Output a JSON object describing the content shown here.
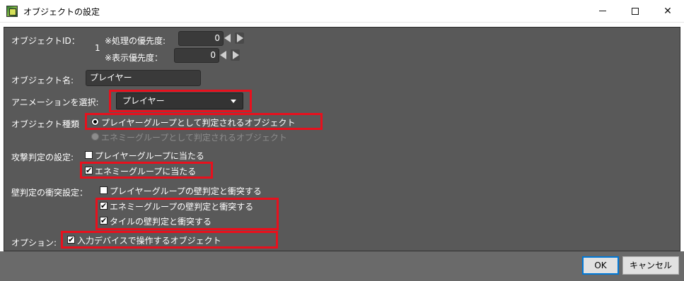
{
  "window": {
    "title": "オブジェクトの設定",
    "controls": {
      "minimize": "minimize",
      "maximize": "maximize",
      "close": "✕"
    }
  },
  "object_id": {
    "label": "オブジェクトID：",
    "value": "1"
  },
  "priority": {
    "process_label": "※処理の優先度:",
    "process_value": "0",
    "display_label": "※表示優先度：",
    "display_value": "0"
  },
  "object_name": {
    "label": "オブジェクト名:",
    "value": "プレイヤー"
  },
  "animation": {
    "label": "アニメーションを選択:",
    "selected": "プレイヤー"
  },
  "object_type": {
    "label": "オブジェクト種類",
    "options": [
      {
        "label": "プレイヤーグループとして判定されるオブジェクト",
        "checked": true,
        "enabled": true
      },
      {
        "label": "エネミーグループとして判定されるオブジェクト",
        "checked": false,
        "enabled": false
      }
    ]
  },
  "attack": {
    "label": "攻撃判定の設定:",
    "options": [
      {
        "label": "プレイヤーグループに当たる",
        "checked": false
      },
      {
        "label": "エネミーグループに当たる",
        "checked": true
      }
    ]
  },
  "wall": {
    "label": "壁判定の衝突設定：",
    "options": [
      {
        "label": "プレイヤーグループの壁判定と衝突する",
        "checked": false
      },
      {
        "label": "エネミーグループの壁判定と衝突する",
        "checked": true
      },
      {
        "label": "タイルの壁判定と衝突する",
        "checked": true
      }
    ]
  },
  "option": {
    "label": "オプション:",
    "options": [
      {
        "label": "入力デバイスで操作するオブジェクト",
        "checked": true
      }
    ]
  },
  "buttons": {
    "ok": "OK",
    "cancel": "キャンセル"
  },
  "colors": {
    "panel": "#595959",
    "highlight": "#e8101d",
    "ok_border": "#0078d7"
  },
  "icons": {
    "app": "app-icon",
    "checkmark": "✔"
  }
}
